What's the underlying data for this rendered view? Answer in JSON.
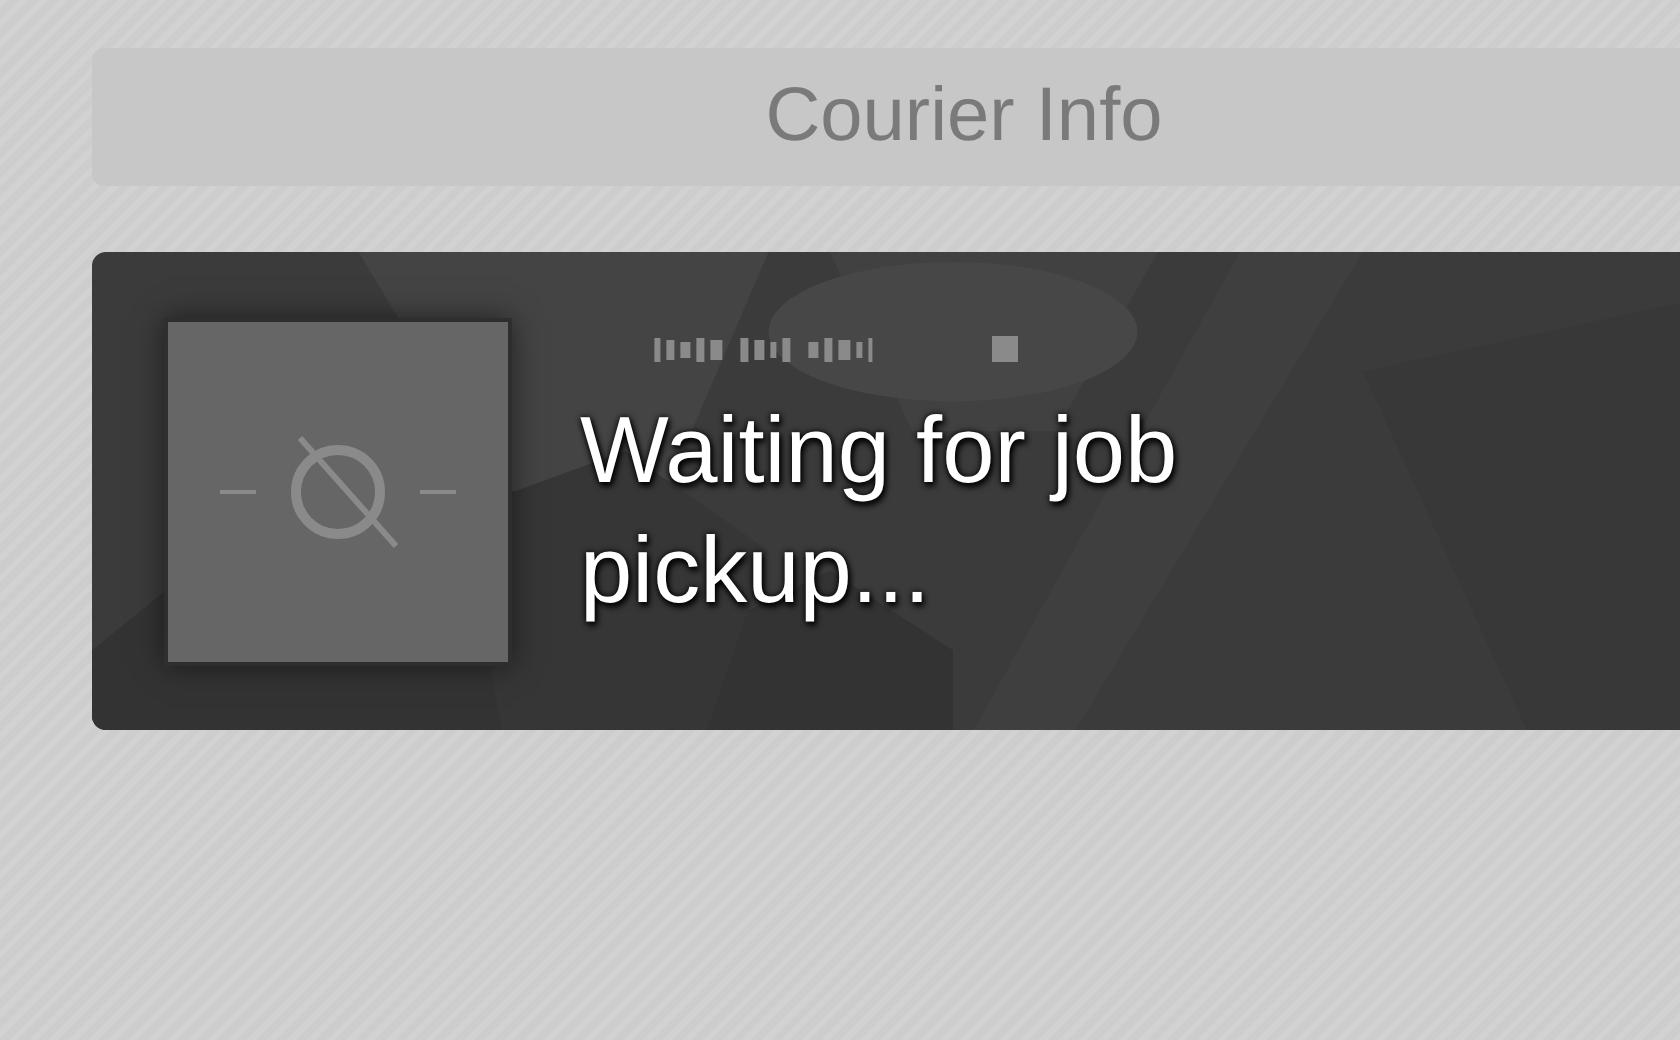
{
  "header": {
    "title": "Courier Info"
  },
  "courier_card": {
    "status": "Waiting for job pickup..."
  }
}
